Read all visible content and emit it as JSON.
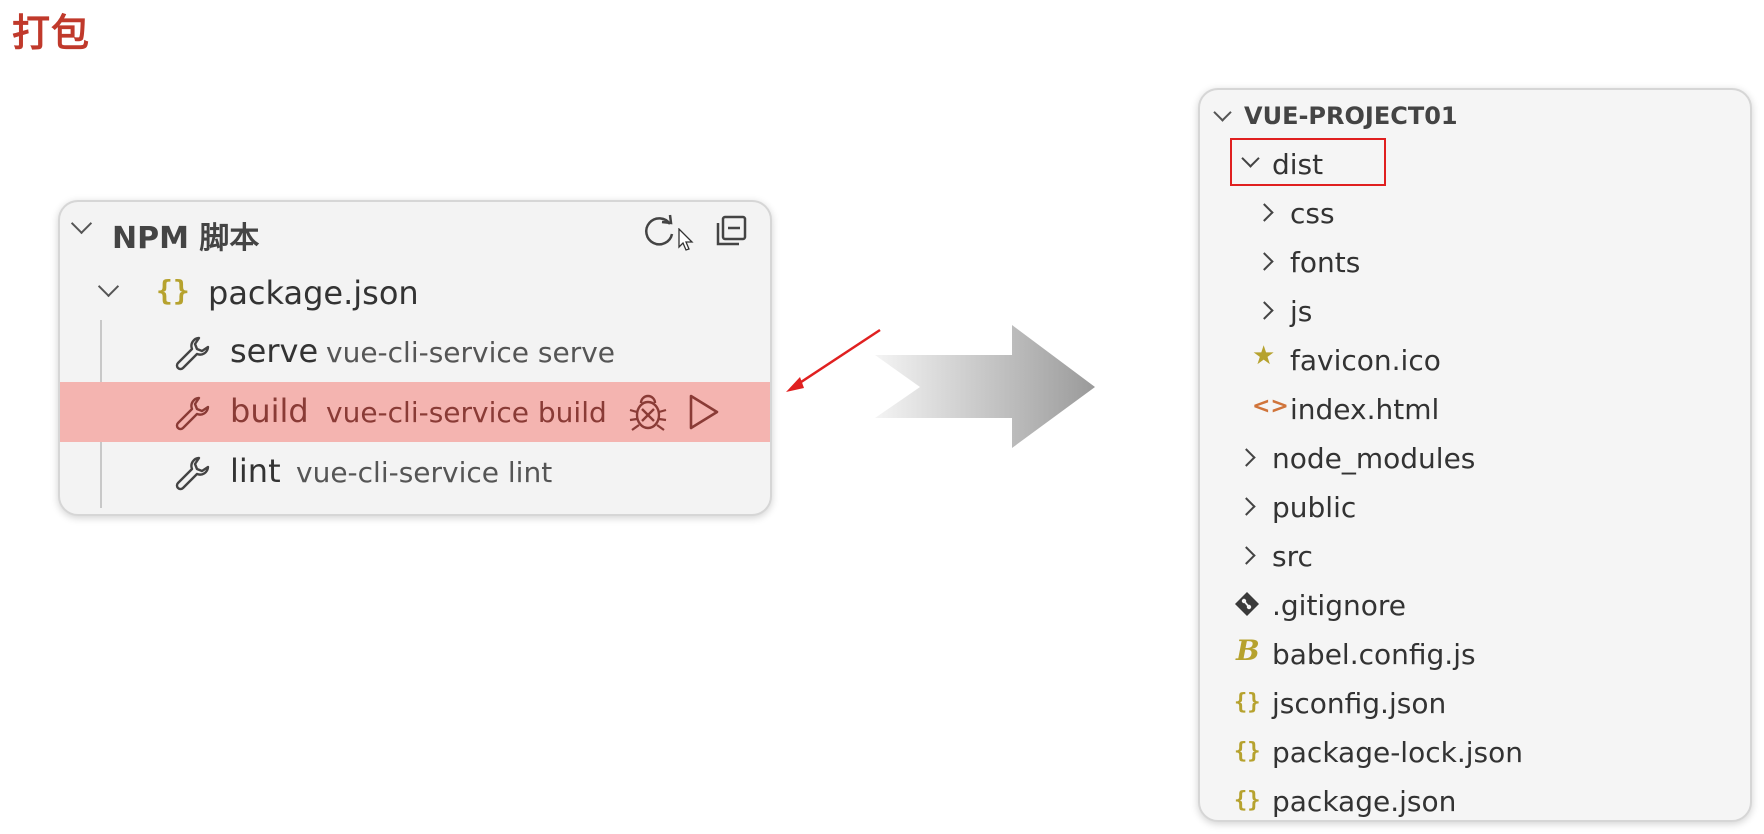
{
  "page_title": "打包",
  "npm_panel": {
    "header_title": "NPM 脚本",
    "package_label": "package.json",
    "scripts": [
      {
        "name": "serve",
        "command": "vue-cli-service serve"
      },
      {
        "name": "build",
        "command": "vue-cli-service build"
      },
      {
        "name": "lint",
        "command": "vue-cli-service lint"
      }
    ],
    "highlight_color": "#f4b4b0"
  },
  "explorer": {
    "title": "VUE-PROJECT01",
    "items": [
      {
        "label": "dist",
        "icon": "chevron-down-icon"
      },
      {
        "label": "css",
        "icon": "chevron-right-icon"
      },
      {
        "label": "fonts",
        "icon": "chevron-right-icon"
      },
      {
        "label": "js",
        "icon": "chevron-right-icon"
      },
      {
        "label": "favicon.ico",
        "icon": "star-icon"
      },
      {
        "label": "index.html",
        "icon": "html-icon"
      },
      {
        "label": "node_modules",
        "icon": "chevron-right-icon"
      },
      {
        "label": "public",
        "icon": "chevron-right-icon"
      },
      {
        "label": "src",
        "icon": "chevron-right-icon"
      },
      {
        "label": ".gitignore",
        "icon": "git-icon"
      },
      {
        "label": "babel.config.js",
        "icon": "babel-icon"
      },
      {
        "label": "jsconfig.json",
        "icon": "json-braces-icon"
      },
      {
        "label": "package-lock.json",
        "icon": "json-braces-icon"
      },
      {
        "label": "package.json",
        "icon": "json-braces-icon"
      }
    ]
  },
  "colors": {
    "title_red": "#c0392b",
    "annotation_red": "#e02020",
    "json_icon": "#b6a22e"
  }
}
